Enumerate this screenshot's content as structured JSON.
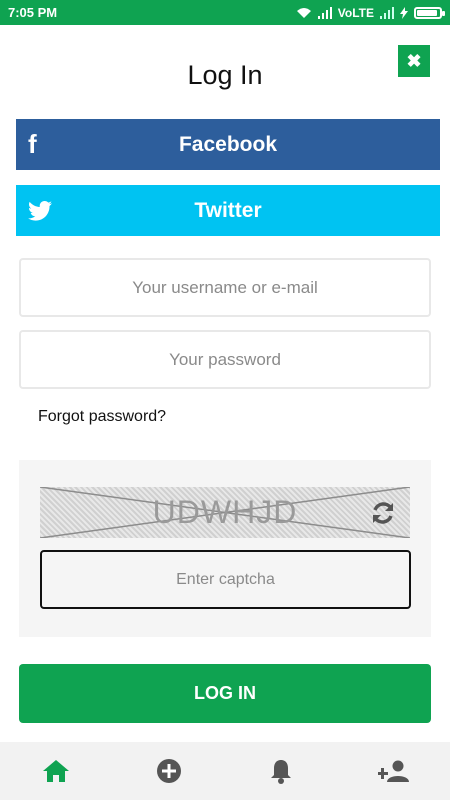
{
  "status_bar": {
    "time": "7:05 PM",
    "network": "VoLTE",
    "battery_level": 0.9
  },
  "title": "Log In",
  "close_icon": "close-icon",
  "social": {
    "facebook_label": "Facebook",
    "facebook_icon": "f",
    "twitter_label": "Twitter",
    "twitter_icon": "twitter-bird-icon",
    "facebook_color": "#2d5e9c",
    "twitter_color": "#00c3f2"
  },
  "form": {
    "username_placeholder": "Your username or e-mail",
    "username_value": "",
    "password_placeholder": "Your password",
    "password_value": "",
    "forgot_label": "Forgot password?"
  },
  "captcha": {
    "code": "UDWHJD",
    "input_placeholder": "Enter captcha",
    "input_value": ""
  },
  "login_label": "LOG IN",
  "accent_color": "#0fa351",
  "bottom_nav": [
    {
      "icon": "home-icon",
      "active": true
    },
    {
      "icon": "add-circle-icon",
      "active": false
    },
    {
      "icon": "bell-icon",
      "active": false
    },
    {
      "icon": "add-user-icon",
      "active": false
    }
  ]
}
